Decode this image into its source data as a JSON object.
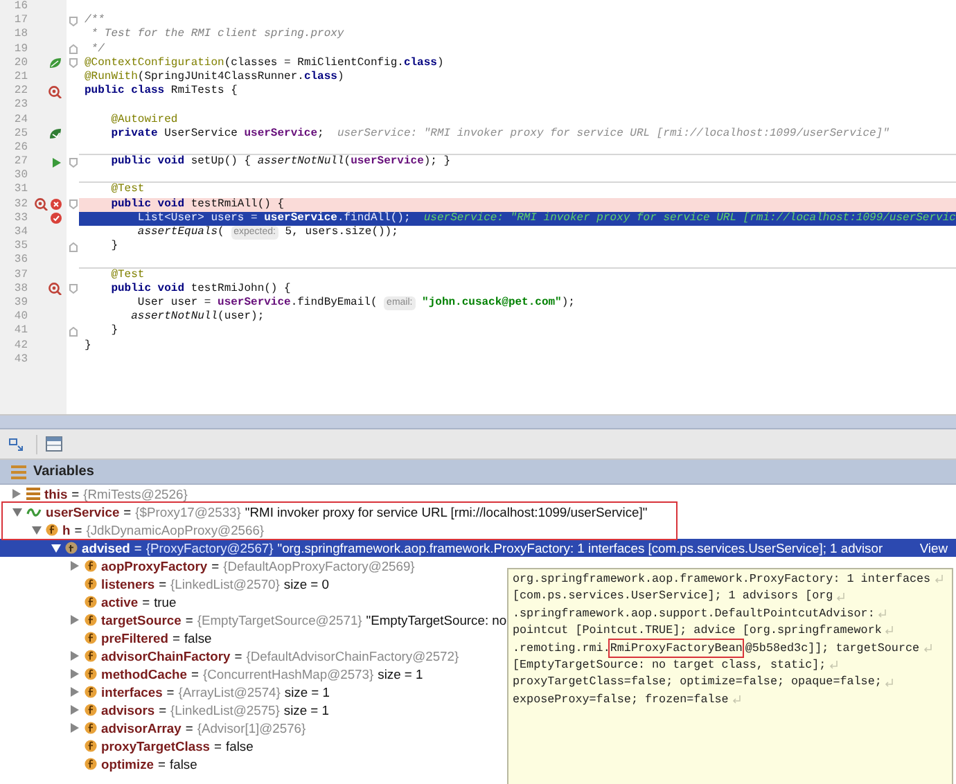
{
  "editor": {
    "lines": [
      {
        "number": "16",
        "kind": "normal",
        "separator": false
      },
      {
        "number": "17",
        "kind": "normal",
        "fold": {
          "kind": "open"
        },
        "separator": false,
        "tokens": [
          {
            "kind": "comment",
            "text": "/**"
          }
        ]
      },
      {
        "number": "18",
        "kind": "normal",
        "separator": false,
        "tokens": [
          {
            "kind": "comment",
            "text": " * Test for the RMI client spring.proxy"
          }
        ]
      },
      {
        "number": "19",
        "kind": "normal",
        "fold": {
          "kind": "close"
        },
        "separator": false,
        "tokens": [
          {
            "kind": "comment",
            "text": " */"
          }
        ]
      },
      {
        "number": "20",
        "kind": "normal",
        "gutter": [
          {
            "kind": "bean"
          }
        ],
        "fold": {
          "kind": "open"
        },
        "separator": false,
        "tokens": [
          {
            "kind": "annotation",
            "text": "@ContextConfiguration"
          },
          {
            "kind": "plain",
            "text": "(classes = RmiClientConfig."
          },
          {
            "kind": "keyword",
            "text": "class"
          },
          {
            "kind": "plain",
            "text": ")"
          }
        ]
      },
      {
        "number": "21",
        "kind": "normal",
        "separator": false,
        "tokens": [
          {
            "kind": "annotation",
            "text": "@RunWith"
          },
          {
            "kind": "plain",
            "text": "(SpringJUnit4ClassRunner."
          },
          {
            "kind": "keyword",
            "text": "class"
          },
          {
            "kind": "plain",
            "text": ")"
          }
        ]
      },
      {
        "number": "22",
        "kind": "normal",
        "gutter": [
          {
            "kind": "test"
          }
        ],
        "separator": false,
        "tokens": [
          {
            "kind": "keyword",
            "text": "public class "
          },
          {
            "kind": "plain",
            "text": "RmiTests {"
          }
        ]
      },
      {
        "number": "23",
        "kind": "normal",
        "separator": false
      },
      {
        "number": "24",
        "kind": "normal",
        "separator": false,
        "tokens": [
          {
            "kind": "annotation",
            "text": "    @Autowired"
          }
        ]
      },
      {
        "number": "25",
        "kind": "normal",
        "gutter": [
          {
            "kind": "injected"
          }
        ],
        "separator": false,
        "tokens": [
          {
            "kind": "keyword",
            "text": "    private "
          },
          {
            "kind": "plain",
            "text": "UserService "
          },
          {
            "kind": "field",
            "text": "userService"
          },
          {
            "kind": "plain",
            "text": ";  "
          },
          {
            "kind": "inline-value",
            "text": "userService: \"RMI invoker proxy for service URL [rmi://localhost:1099/userService]\""
          }
        ]
      },
      {
        "number": "26",
        "kind": "normal",
        "separator": true
      },
      {
        "number": "27",
        "kind": "normal",
        "gutter": [
          {
            "kind": "run"
          }
        ],
        "fold": {
          "kind": "open"
        },
        "separator": false,
        "tokens": [
          {
            "kind": "keyword",
            "text": "    public void "
          },
          {
            "kind": "plain",
            "text": "setUp() { "
          },
          {
            "kind": "static",
            "text": "assertNotNull"
          },
          {
            "kind": "plain",
            "text": "("
          },
          {
            "kind": "field",
            "text": "userService"
          },
          {
            "kind": "plain",
            "text": "); }"
          }
        ]
      },
      {
        "number": "30",
        "kind": "normal",
        "separator": true
      },
      {
        "number": "31",
        "kind": "normal",
        "separator": false,
        "tokens": [
          {
            "kind": "annotation",
            "text": "    @Test"
          }
        ]
      },
      {
        "number": "32",
        "kind": "breakpoint",
        "gutter": [
          {
            "kind": "test"
          },
          {
            "kind": "breakpoint"
          }
        ],
        "fold": {
          "kind": "open"
        },
        "separator": false,
        "tokens": [
          {
            "kind": "keyword",
            "text": "    public void "
          },
          {
            "kind": "plain",
            "text": "testRmiAll() {"
          }
        ]
      },
      {
        "number": "33",
        "kind": "current",
        "gutter": [
          {
            "kind": "breakpoint-hit"
          }
        ],
        "separator": false,
        "tokens": [
          {
            "kind": "plain",
            "text": "        List<User> users = "
          },
          {
            "kind": "field",
            "text": "userService"
          },
          {
            "kind": "plain",
            "text": ".findAll();  "
          },
          {
            "kind": "inline-value",
            "text": "userService: \"RMI invoker proxy for service URL [rmi://localhost:1099/userServic"
          }
        ]
      },
      {
        "number": "34",
        "kind": "normal",
        "separator": false,
        "tokens": [
          {
            "kind": "static",
            "text": "        assertEquals"
          },
          {
            "kind": "plain",
            "text": "( "
          },
          {
            "kind": "hint",
            "text": "expected:"
          },
          {
            "kind": "plain",
            "text": " 5, users.size());"
          }
        ]
      },
      {
        "number": "35",
        "kind": "normal",
        "fold": {
          "kind": "close"
        },
        "separator": false,
        "tokens": [
          {
            "kind": "plain",
            "text": "    }"
          }
        ]
      },
      {
        "number": "36",
        "kind": "normal",
        "separator": true
      },
      {
        "number": "37",
        "kind": "normal",
        "separator": false,
        "tokens": [
          {
            "kind": "annotation",
            "text": "    @Test"
          }
        ]
      },
      {
        "number": "38",
        "kind": "normal",
        "gutter": [
          {
            "kind": "test"
          }
        ],
        "fold": {
          "kind": "open"
        },
        "separator": false,
        "tokens": [
          {
            "kind": "keyword",
            "text": "    public void "
          },
          {
            "kind": "plain",
            "text": "testRmiJohn() {"
          }
        ]
      },
      {
        "number": "39",
        "kind": "normal",
        "separator": false,
        "tokens": [
          {
            "kind": "plain",
            "text": "        User user = "
          },
          {
            "kind": "field",
            "text": "userService"
          },
          {
            "kind": "plain",
            "text": ".findByEmail( "
          },
          {
            "kind": "hint",
            "text": "email:"
          },
          {
            "kind": "string",
            "text": " \"john.cusack@pet.com\""
          },
          {
            "kind": "plain",
            "text": ");"
          }
        ]
      },
      {
        "number": "40",
        "kind": "normal",
        "separator": false,
        "tokens": [
          {
            "kind": "static",
            "text": "       assertNotNull"
          },
          {
            "kind": "plain",
            "text": "(user);"
          }
        ]
      },
      {
        "number": "41",
        "kind": "normal",
        "fold": {
          "kind": "close"
        },
        "separator": false,
        "tokens": [
          {
            "kind": "plain",
            "text": "    }"
          }
        ]
      },
      {
        "number": "42",
        "kind": "normal",
        "separator": false,
        "tokens": [
          {
            "kind": "plain",
            "text": "}"
          }
        ]
      },
      {
        "number": "43",
        "kind": "normal",
        "separator": false
      }
    ]
  },
  "debugger": {
    "panel_title": "Variables",
    "variables": [
      {
        "kind": "object",
        "name": "this",
        "sign": "=",
        "ref": "{RmiTests@2526}",
        "expanded": false,
        "selected": false,
        "boxed": false
      },
      {
        "kind": "bean",
        "name": "userService",
        "sign": "=",
        "ref": "{$Proxy17@2533}",
        "detail": "\"RMI invoker proxy for service URL [rmi://localhost:1099/userService]\"",
        "expanded": true,
        "selected": false,
        "boxed": true,
        "children": [
          {
            "kind": "field",
            "name": "h",
            "sign": "=",
            "ref": "{JdkDynamicAopProxy@2566}",
            "expanded": true,
            "selected": false,
            "boxed": true,
            "children": [
              {
                "kind": "final-field",
                "name": "advised",
                "sign": "=",
                "ref": "{ProxyFactory@2567}",
                "detail": "\"org.springframework.aop.framework.ProxyFactory: 1 interfaces [com.ps.services.UserService]; 1 advisor",
                "action": "View",
                "expanded": true,
                "selected": true,
                "boxed": false,
                "children": [
                  {
                    "kind": "field",
                    "name": "aopProxyFactory",
                    "sign": "=",
                    "ref": "{DefaultAopProxyFactory@2569}",
                    "expanded": false,
                    "selected": false,
                    "boxed": false
                  },
                  {
                    "kind": "field",
                    "name": "listeners",
                    "sign": "=",
                    "ref": "{LinkedList@2570}",
                    "detail": "size = 0",
                    "selected": false,
                    "boxed": false
                  },
                  {
                    "kind": "field",
                    "name": "active",
                    "sign": "=",
                    "detail": "true",
                    "selected": false,
                    "boxed": false
                  },
                  {
                    "kind": "field",
                    "name": "targetSource",
                    "sign": "=",
                    "ref": "{EmptyTargetSource@2571}",
                    "detail": "\"EmptyTargetSource: no",
                    "expanded": false,
                    "selected": false,
                    "boxed": false
                  },
                  {
                    "kind": "field",
                    "name": "preFiltered",
                    "sign": "=",
                    "detail": "false",
                    "selected": false,
                    "boxed": false
                  },
                  {
                    "kind": "field",
                    "name": "advisorChainFactory",
                    "sign": "=",
                    "ref": "{DefaultAdvisorChainFactory@2572}",
                    "expanded": false,
                    "selected": false,
                    "boxed": false
                  },
                  {
                    "kind": "field",
                    "name": "methodCache",
                    "sign": "=",
                    "ref": "{ConcurrentHashMap@2573}",
                    "detail": "size = 1",
                    "expanded": false,
                    "selected": false,
                    "boxed": false
                  },
                  {
                    "kind": "field",
                    "name": "interfaces",
                    "sign": "=",
                    "ref": "{ArrayList@2574}",
                    "detail": "size = 1",
                    "expanded": false,
                    "selected": false,
                    "boxed": false
                  },
                  {
                    "kind": "field",
                    "name": "advisors",
                    "sign": "=",
                    "ref": "{LinkedList@2575}",
                    "detail": "size = 1",
                    "expanded": false,
                    "selected": false,
                    "boxed": false
                  },
                  {
                    "kind": "field",
                    "name": "advisorArray",
                    "sign": "=",
                    "ref": "{Advisor[1]@2576}",
                    "expanded": false,
                    "selected": false,
                    "boxed": false
                  },
                  {
                    "kind": "field",
                    "name": "proxyTargetClass",
                    "sign": "=",
                    "detail": "false",
                    "selected": false,
                    "boxed": false
                  },
                  {
                    "kind": "field",
                    "name": "optimize",
                    "sign": "=",
                    "detail": "false",
                    "selected": false,
                    "boxed": false
                  }
                ]
              }
            ]
          }
        ]
      }
    ],
    "tooltip": {
      "lines": [
        [
          {
            "text": "org.springframework.aop.framework.ProxyFactory: 1 interfaces",
            "highlighted": false
          }
        ],
        [
          {
            "text": "[com.ps.services.UserService]; 1 advisors [org",
            "highlighted": false
          }
        ],
        [
          {
            "text": ".springframework.aop.support.DefaultPointcutAdvisor:",
            "highlighted": false
          }
        ],
        [
          {
            "text": "pointcut [Pointcut.TRUE]; advice [org.springframework",
            "highlighted": false
          }
        ],
        [
          {
            "text": ".remoting.rmi.",
            "highlighted": false
          },
          {
            "text": "RmiProxyFactoryBean",
            "highlighted": true
          },
          {
            "text": "@5b58ed3c]]; targetSource",
            "highlighted": false
          }
        ],
        [
          {
            "text": "[EmptyTargetSource: no target class, static];",
            "highlighted": false
          }
        ],
        [
          {
            "text": "proxyTargetClass=false; optimize=false; opaque=false;",
            "highlighted": false
          }
        ],
        [
          {
            "text": "exposeProxy=false; frozen=false",
            "highlighted": false
          }
        ]
      ]
    }
  }
}
